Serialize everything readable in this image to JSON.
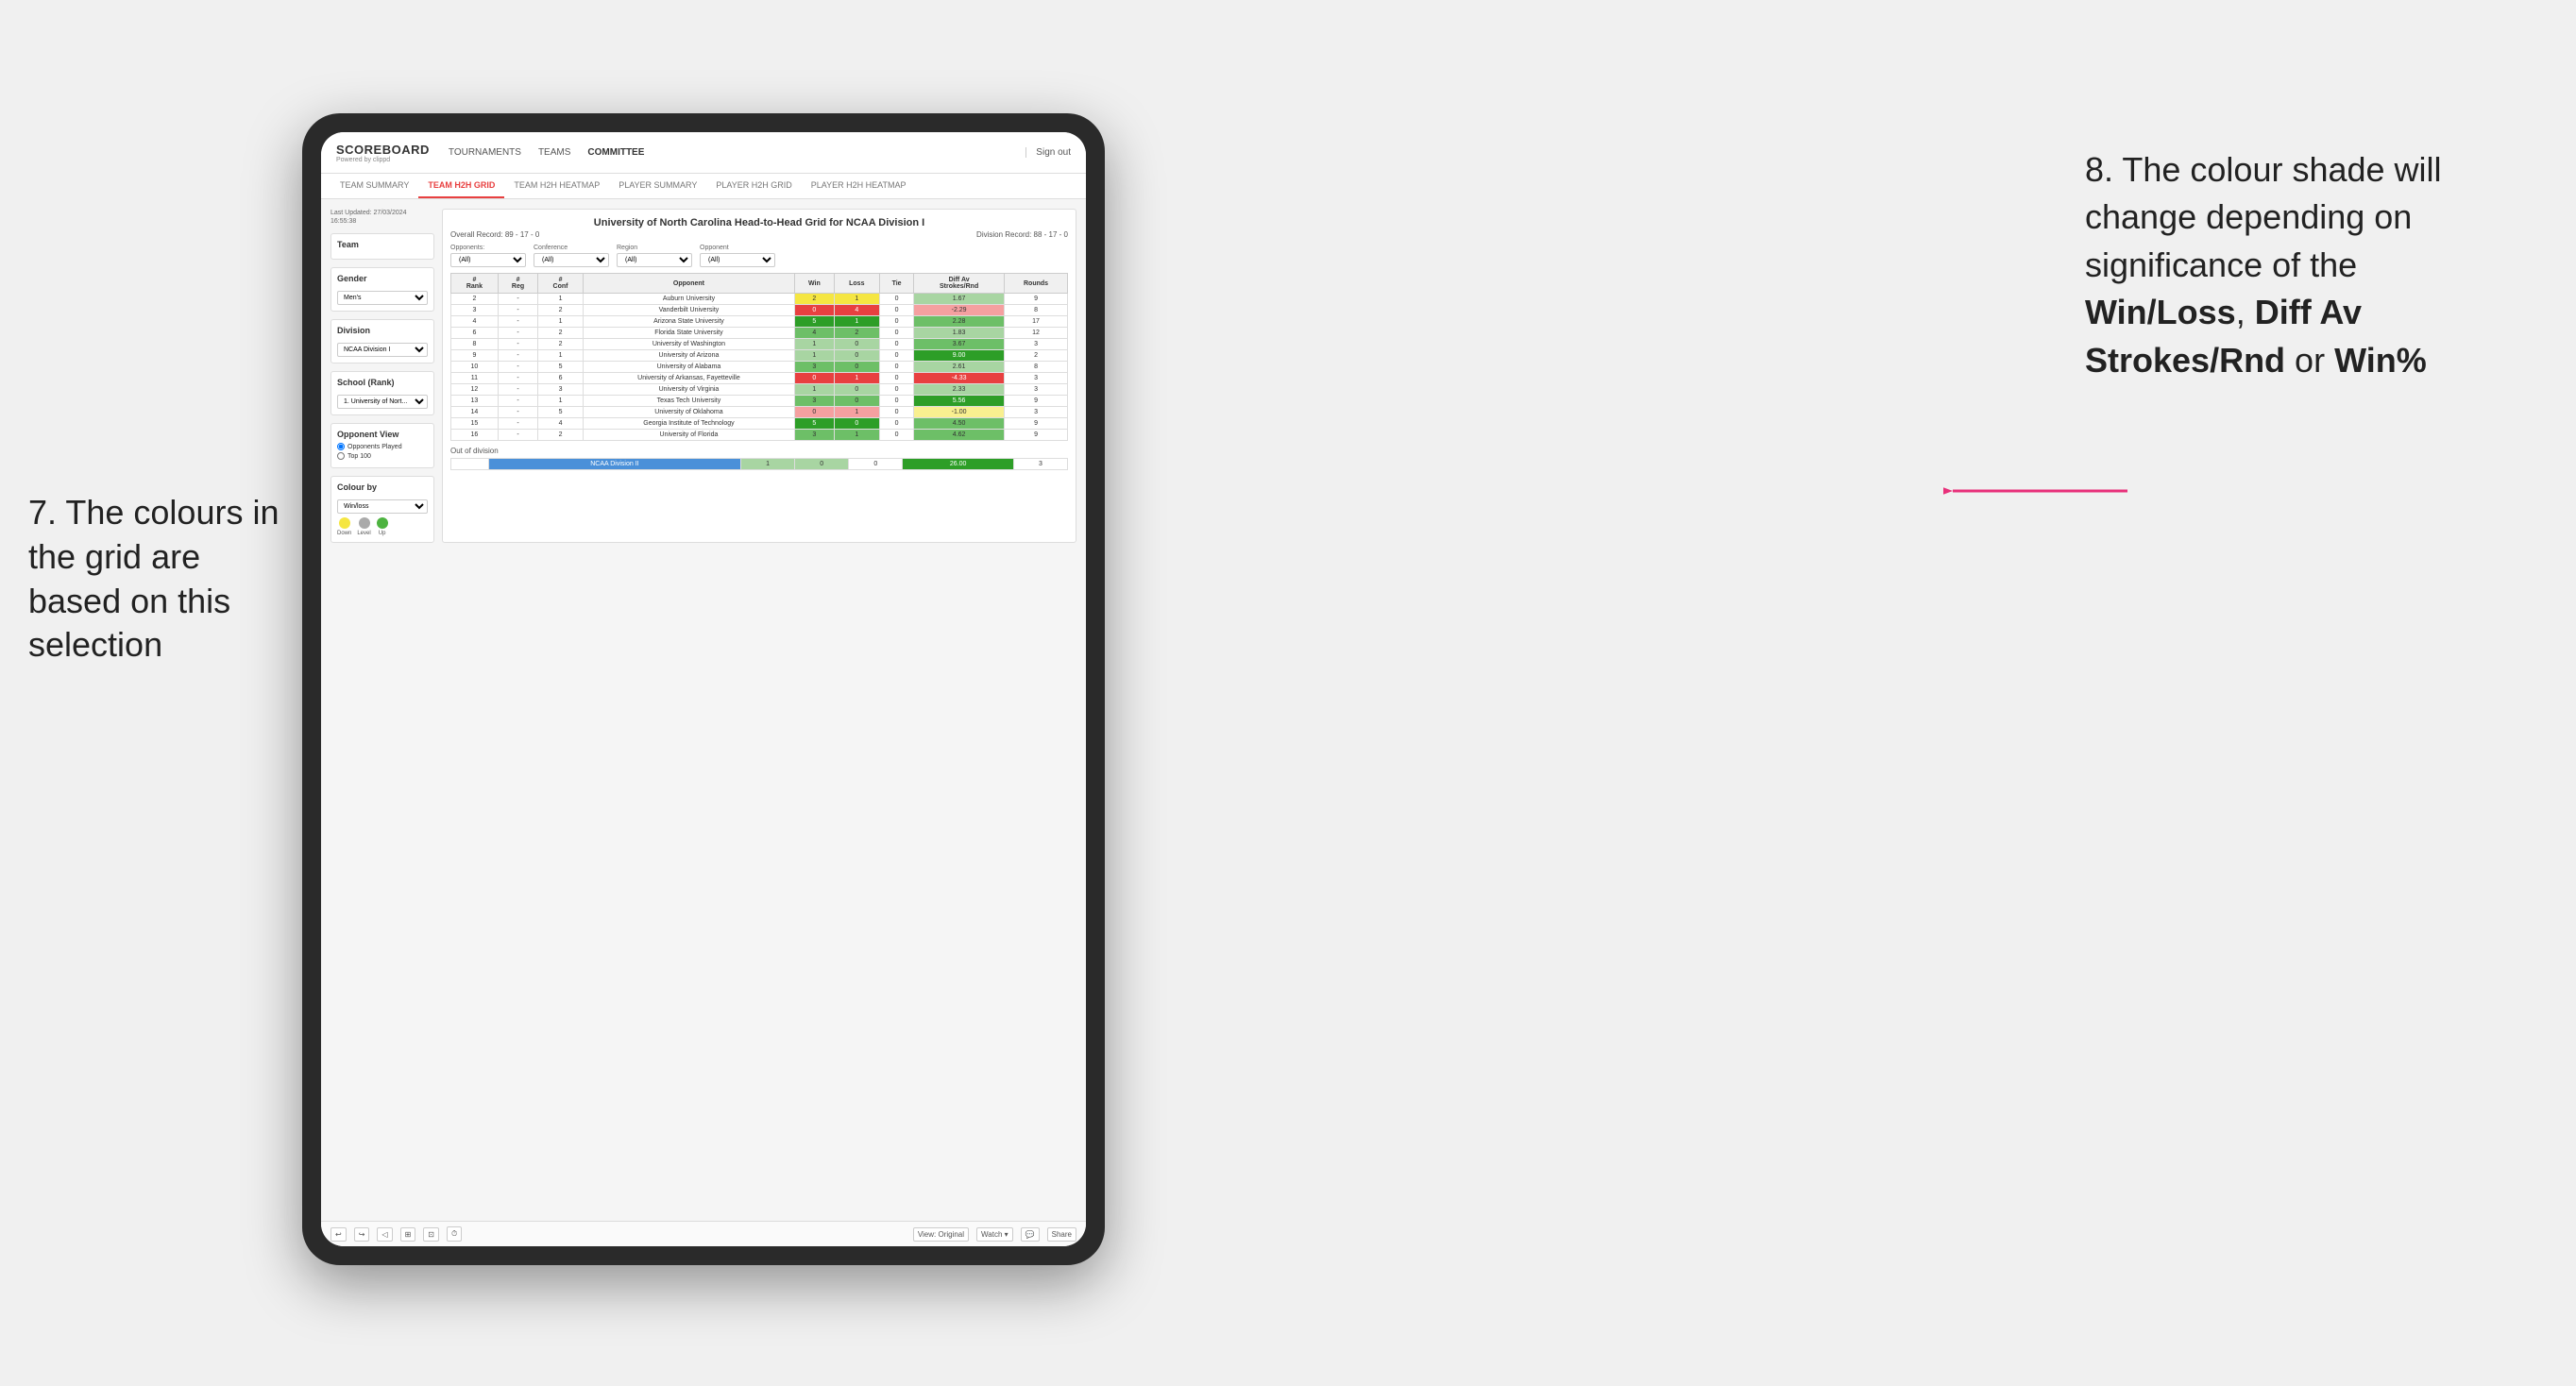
{
  "annotations": {
    "left_text": "7. The colours in the grid are based on this selection",
    "right_text_prefix": "8. The colour shade will change depending on significance of the ",
    "right_text_bold1": "Win/Loss",
    "right_text_comma": ", ",
    "right_text_bold2": "Diff Av Strokes/Rnd",
    "right_text_or": " or ",
    "right_text_bold3": "Win%"
  },
  "nav": {
    "logo": "SCOREBOARD",
    "logo_sub": "Powered by clippd",
    "links": [
      "TOURNAMENTS",
      "TEAMS",
      "COMMITTEE"
    ],
    "sign_out": "Sign out"
  },
  "sub_tabs": [
    "TEAM SUMMARY",
    "TEAM H2H GRID",
    "TEAM H2H HEATMAP",
    "PLAYER SUMMARY",
    "PLAYER H2H GRID",
    "PLAYER H2H HEATMAP"
  ],
  "active_tab": "TEAM H2H GRID",
  "panel": {
    "last_updated_label": "Last Updated: 27/03/2024",
    "last_updated_time": "16:55:38",
    "team_label": "Team",
    "gender_label": "Gender",
    "gender_value": "Men's",
    "division_label": "Division",
    "division_value": "NCAA Division I",
    "school_label": "School (Rank)",
    "school_value": "1. University of Nort...",
    "opponent_view_label": "Opponent View",
    "opponents_played": "Opponents Played",
    "top_100": "Top 100",
    "colour_by_label": "Colour by",
    "colour_by_value": "Win/loss",
    "legend_down": "Down",
    "legend_level": "Level",
    "legend_up": "Up"
  },
  "grid": {
    "title": "University of North Carolina Head-to-Head Grid for NCAA Division I",
    "overall_record_label": "Overall Record:",
    "overall_record": "89 - 17 - 0",
    "division_record_label": "Division Record:",
    "division_record": "88 - 17 - 0",
    "filters": {
      "opponents_label": "Opponents:",
      "opponents_value": "(All)",
      "conference_label": "Conference",
      "conference_value": "(All)",
      "region_label": "Region",
      "region_value": "(All)",
      "opponent_label": "Opponent",
      "opponent_value": "(All)"
    },
    "columns": [
      "#\nRank",
      "#\nReg",
      "#\nConf",
      "Opponent",
      "Win",
      "Loss",
      "Tie",
      "Diff Av\nStrokes/Rnd",
      "Rounds"
    ],
    "rows": [
      {
        "rank": "2",
        "reg": "-",
        "conf": "1",
        "opponent": "Auburn University",
        "win": "2",
        "loss": "1",
        "tie": "0",
        "diff": "1.67",
        "rounds": "9",
        "win_color": "yellow",
        "diff_color": "green_light"
      },
      {
        "rank": "3",
        "reg": "-",
        "conf": "2",
        "opponent": "Vanderbilt University",
        "win": "0",
        "loss": "4",
        "tie": "0",
        "diff": "-2.29",
        "rounds": "8",
        "win_color": "red",
        "diff_color": "red_light"
      },
      {
        "rank": "4",
        "reg": "-",
        "conf": "1",
        "opponent": "Arizona State University",
        "win": "5",
        "loss": "1",
        "tie": "0",
        "diff": "2.28",
        "rounds": "17",
        "win_color": "green_dark",
        "diff_color": "green_mid"
      },
      {
        "rank": "6",
        "reg": "-",
        "conf": "2",
        "opponent": "Florida State University",
        "win": "4",
        "loss": "2",
        "tie": "0",
        "diff": "1.83",
        "rounds": "12",
        "win_color": "green_mid",
        "diff_color": "green_light"
      },
      {
        "rank": "8",
        "reg": "-",
        "conf": "2",
        "opponent": "University of Washington",
        "win": "1",
        "loss": "0",
        "tie": "0",
        "diff": "3.67",
        "rounds": "3",
        "win_color": "green_light",
        "diff_color": "green_mid"
      },
      {
        "rank": "9",
        "reg": "-",
        "conf": "1",
        "opponent": "University of Arizona",
        "win": "1",
        "loss": "0",
        "tie": "0",
        "diff": "9.00",
        "rounds": "2",
        "win_color": "green_light",
        "diff_color": "green_dark"
      },
      {
        "rank": "10",
        "reg": "-",
        "conf": "5",
        "opponent": "University of Alabama",
        "win": "3",
        "loss": "0",
        "tie": "0",
        "diff": "2.61",
        "rounds": "8",
        "win_color": "green_mid",
        "diff_color": "green_light"
      },
      {
        "rank": "11",
        "reg": "-",
        "conf": "6",
        "opponent": "University of Arkansas, Fayetteville",
        "win": "0",
        "loss": "1",
        "tie": "0",
        "diff": "-4.33",
        "rounds": "3",
        "win_color": "red",
        "diff_color": "red"
      },
      {
        "rank": "12",
        "reg": "-",
        "conf": "3",
        "opponent": "University of Virginia",
        "win": "1",
        "loss": "0",
        "tie": "0",
        "diff": "2.33",
        "rounds": "3",
        "win_color": "green_light",
        "diff_color": "green_light"
      },
      {
        "rank": "13",
        "reg": "-",
        "conf": "1",
        "opponent": "Texas Tech University",
        "win": "3",
        "loss": "0",
        "tie": "0",
        "diff": "5.56",
        "rounds": "9",
        "win_color": "green_mid",
        "diff_color": "green_dark"
      },
      {
        "rank": "14",
        "reg": "-",
        "conf": "5",
        "opponent": "University of Oklahoma",
        "win": "0",
        "loss": "1",
        "tie": "0",
        "diff": "-1.00",
        "rounds": "3",
        "win_color": "red_light",
        "diff_color": "yellow_light"
      },
      {
        "rank": "15",
        "reg": "-",
        "conf": "4",
        "opponent": "Georgia Institute of Technology",
        "win": "5",
        "loss": "0",
        "tie": "0",
        "diff": "4.50",
        "rounds": "9",
        "win_color": "green_dark",
        "diff_color": "green_mid"
      },
      {
        "rank": "16",
        "reg": "-",
        "conf": "2",
        "opponent": "University of Florida",
        "win": "3",
        "loss": "1",
        "tie": "0",
        "diff": "4.62",
        "rounds": "9",
        "win_color": "green_mid",
        "diff_color": "green_mid"
      }
    ],
    "out_of_division_label": "Out of division",
    "out_of_division_rows": [
      {
        "label": "NCAA Division II",
        "win": "1",
        "loss": "0",
        "tie": "0",
        "diff": "26.00",
        "rounds": "3",
        "win_color": "green_light",
        "diff_color": "green_dark"
      }
    ]
  },
  "toolbar": {
    "view_label": "View: Original",
    "watch_label": "Watch ▾",
    "share_label": "Share"
  }
}
